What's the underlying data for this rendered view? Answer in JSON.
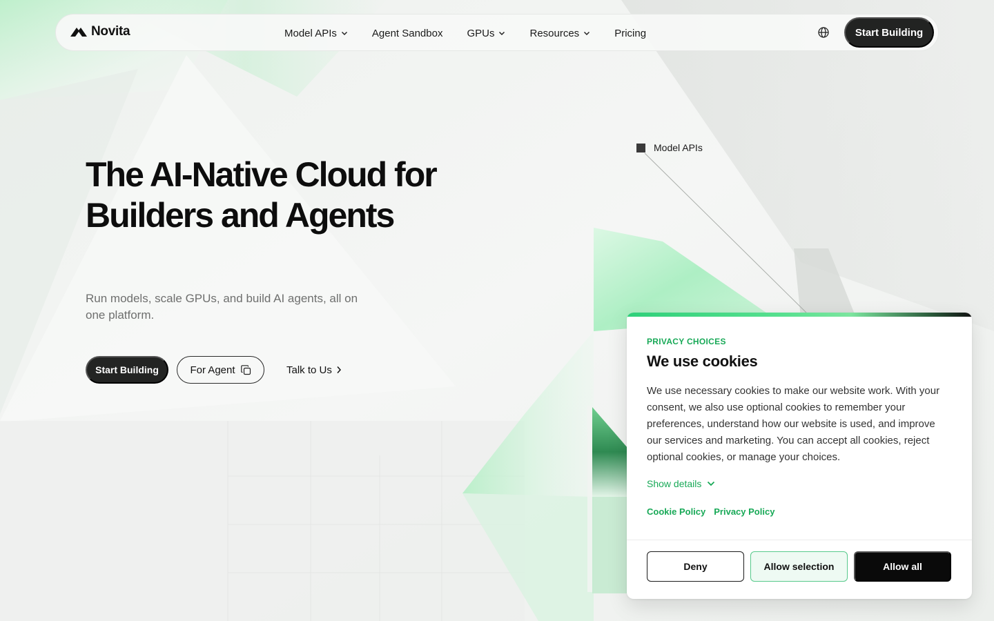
{
  "nav": {
    "logo_text": "Novita",
    "links": [
      {
        "label": "Model APIs",
        "has_dropdown": true
      },
      {
        "label": "Agent Sandbox",
        "has_dropdown": false
      },
      {
        "label": "GPUs",
        "has_dropdown": true
      },
      {
        "label": "Resources",
        "has_dropdown": true
      },
      {
        "label": "Pricing",
        "has_dropdown": false
      }
    ],
    "language_icon": "globe-icon",
    "cta_label": "Start Building"
  },
  "hero": {
    "title": "The AI-Native Cloud for Builders and Agents",
    "subtitle": "Run models, scale GPUs, and build AI agents, all on one platform.",
    "primary_label": "Start Building",
    "secondary_label": "For Agent",
    "secondary_icon": "copy-icon",
    "link_label": "Talk to Us",
    "link_icon": "chevron-right-icon"
  },
  "visual": {
    "tag_label": "Model APIs"
  },
  "cookie": {
    "eyebrow": "PRIVACY CHOICES",
    "title": "We use cookies",
    "text": "We use necessary cookies to make our website work. With your consent, we also use optional cookies to remember your preferences, understand how our website is used, and improve our services and marketing. You can accept all cookies, reject optional cookies, or manage your choices.",
    "show_details": "Show details",
    "cookie_policy": "Cookie Policy",
    "privacy_policy": "Privacy Policy",
    "deny": "Deny",
    "allow_selection": "Allow selection",
    "allow_all": "Allow all",
    "accent_color": "#18a957"
  },
  "colors": {
    "brand_green": "#57e08f",
    "dark_button": "#232423"
  }
}
